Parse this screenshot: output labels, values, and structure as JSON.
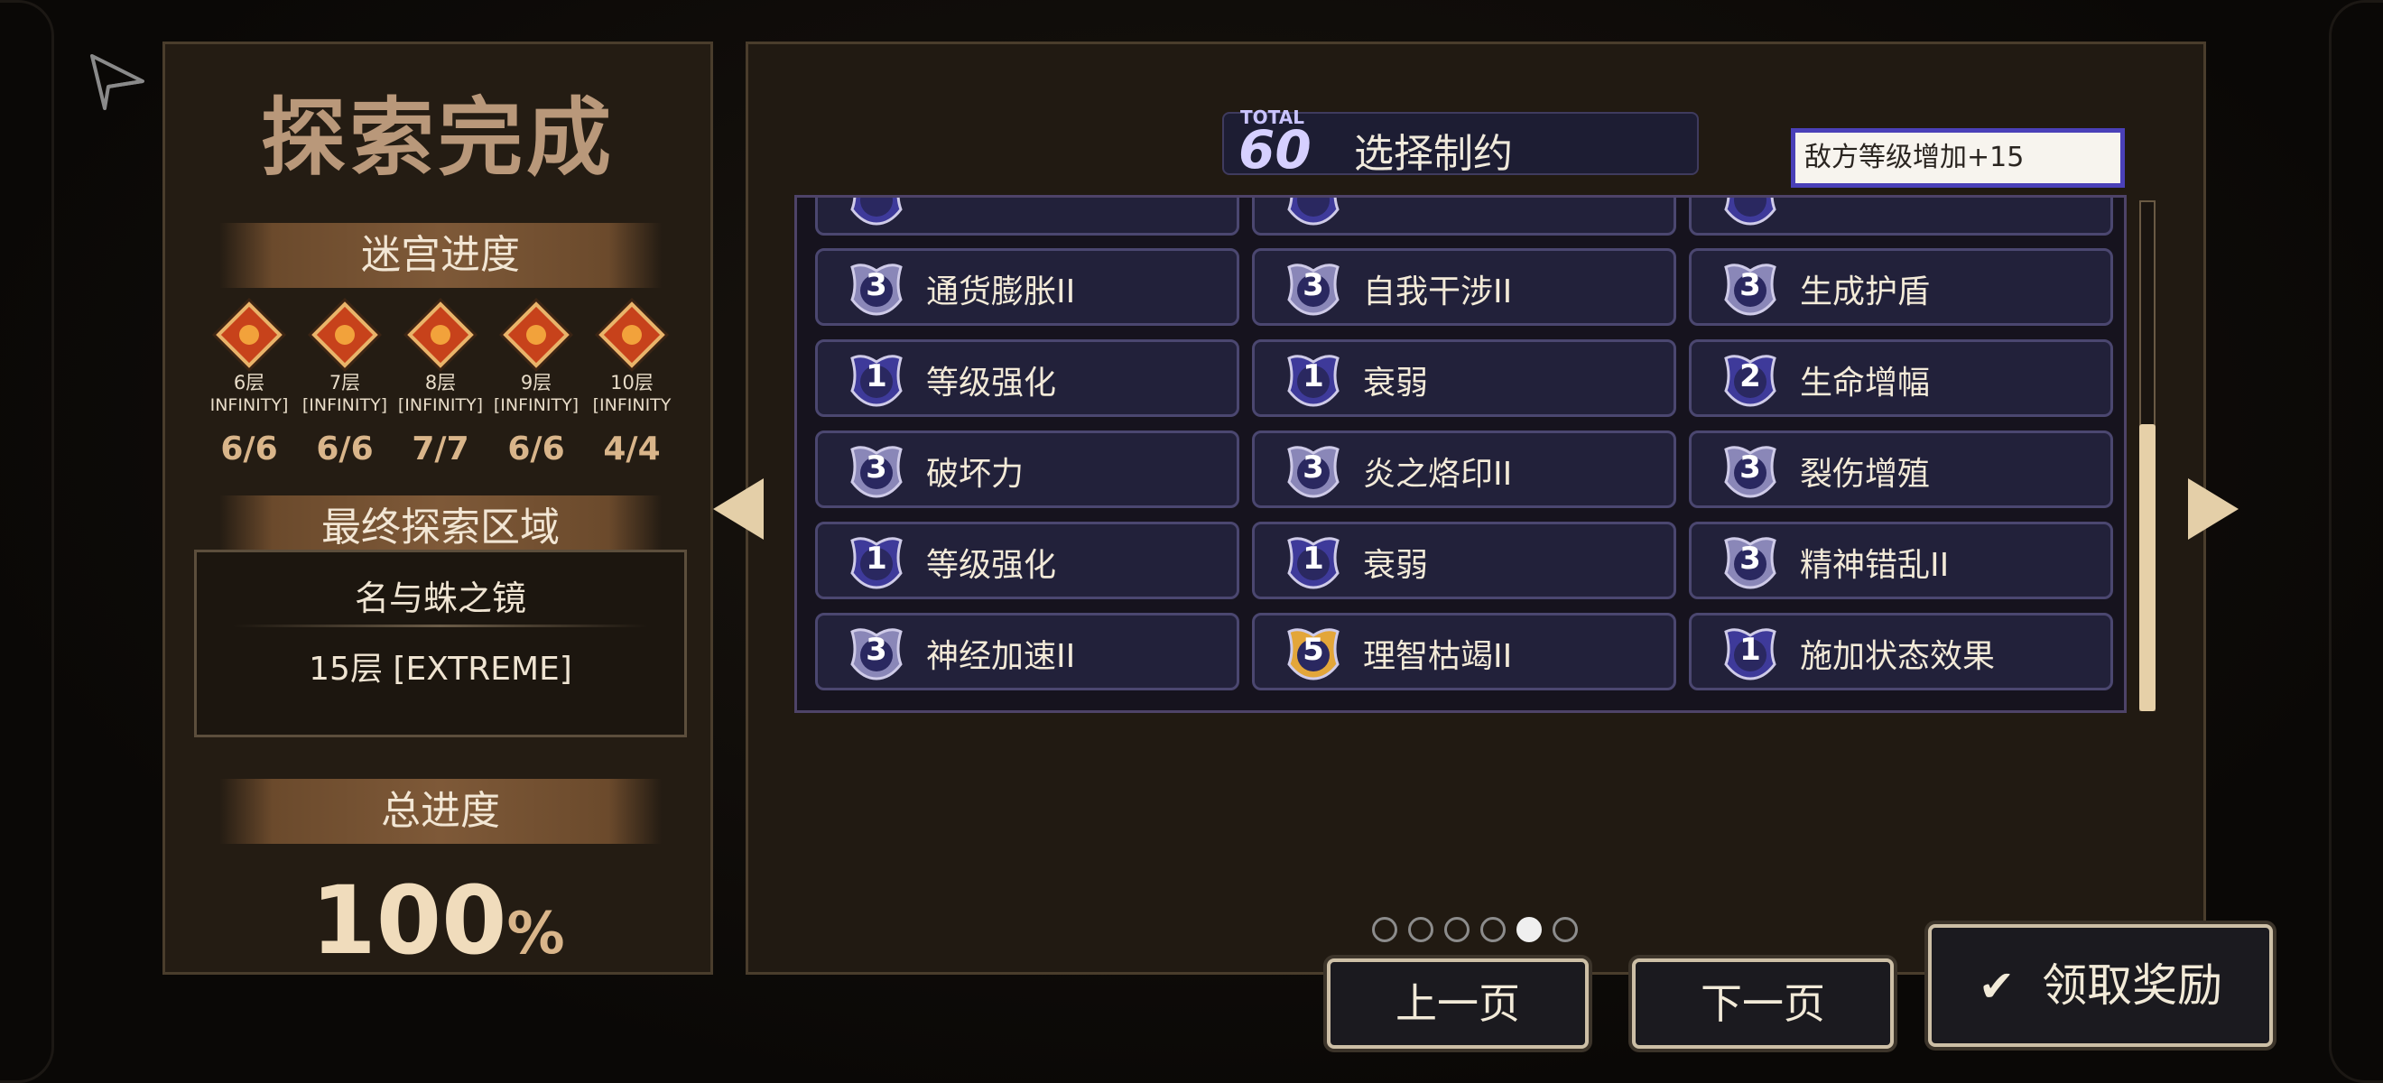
{
  "left": {
    "title": "探索完成",
    "labyrinth_progress_label": "迷宫进度",
    "floors": [
      {
        "name": "6层",
        "mode": "INFINITY]",
        "count": "6/6"
      },
      {
        "name": "7层",
        "mode": "[INFINITY]",
        "count": "6/6"
      },
      {
        "name": "8层",
        "mode": "[INFINITY]",
        "count": "7/7"
      },
      {
        "name": "9层",
        "mode": "[INFINITY]",
        "count": "6/6"
      },
      {
        "name": "10层",
        "mode": "[INFINITY",
        "count": "4/4"
      }
    ],
    "final_region_label": "最终探索区域",
    "region_name": "名与蛛之镜",
    "region_level": "15层 [EXTREME]",
    "total_progress_label": "总进度",
    "total_progress_value": "100",
    "total_progress_unit": "%"
  },
  "header": {
    "total_label": "TOTAL",
    "total_value": "60",
    "title": "选择制约"
  },
  "tooltip": "敌方等级增加+15",
  "restrictions": [
    [
      {
        "level": "3",
        "label": "通货膨胀II",
        "tier": "silver"
      },
      {
        "level": "3",
        "label": "自我干涉II",
        "tier": "silver"
      },
      {
        "level": "3",
        "label": "生成护盾",
        "tier": "silver"
      }
    ],
    [
      {
        "level": "1",
        "label": "等级强化",
        "tier": "blue"
      },
      {
        "level": "1",
        "label": "衰弱",
        "tier": "blue"
      },
      {
        "level": "2",
        "label": "生命增幅",
        "tier": "blue"
      }
    ],
    [
      {
        "level": "3",
        "label": "破坏力",
        "tier": "silver"
      },
      {
        "level": "3",
        "label": "炎之烙印II",
        "tier": "silver"
      },
      {
        "level": "3",
        "label": "裂伤增殖",
        "tier": "silver"
      }
    ],
    [
      {
        "level": "1",
        "label": "等级强化",
        "tier": "blue"
      },
      {
        "level": "1",
        "label": "衰弱",
        "tier": "blue"
      },
      {
        "level": "3",
        "label": "精神错乱II",
        "tier": "silver"
      }
    ],
    [
      {
        "level": "3",
        "label": "神经加速II",
        "tier": "silver"
      },
      {
        "level": "5",
        "label": "理智枯竭II",
        "tier": "gold"
      },
      {
        "level": "1",
        "label": "施加状态效果",
        "tier": "blue"
      }
    ]
  ],
  "pagination": {
    "total": 6,
    "active": 5
  },
  "buttons": {
    "prev": "上一页",
    "next": "下一页",
    "claim": "领取奖励"
  },
  "colors": {
    "silver": "#8a87b8",
    "blue": "#3e3a9a",
    "gold": "#e3a63a"
  }
}
